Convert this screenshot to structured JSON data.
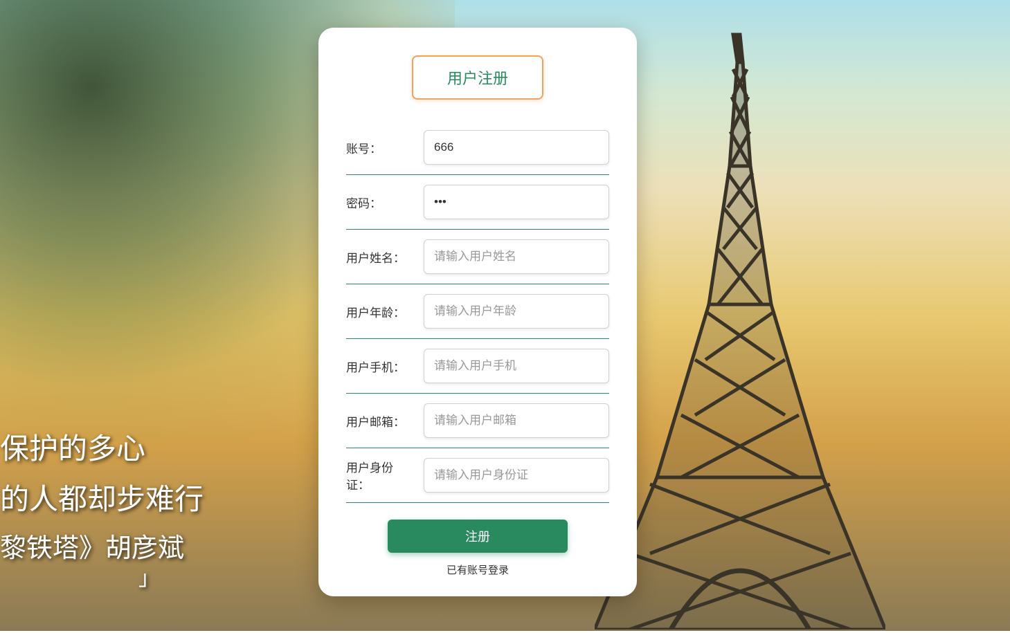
{
  "form": {
    "title": "用户注册",
    "fields": {
      "account": {
        "label": "账号：",
        "value": "666",
        "placeholder": ""
      },
      "password": {
        "label": "密码：",
        "value": "•••",
        "placeholder": ""
      },
      "name": {
        "label": "用户姓名：",
        "value": "",
        "placeholder": "请输入用户姓名"
      },
      "age": {
        "label": "用户年龄：",
        "value": "",
        "placeholder": "请输入用户年龄"
      },
      "phone": {
        "label": "用户手机：",
        "value": "",
        "placeholder": "请输入用户手机"
      },
      "email": {
        "label": "用户邮箱：",
        "value": "",
        "placeholder": "请输入用户邮箱"
      },
      "idcard": {
        "label": "用户身份证：",
        "value": "",
        "placeholder": "请输入用户身份证"
      }
    },
    "submit_label": "注册",
    "login_link": "已有账号登录"
  },
  "caption": {
    "line1": "保护的多心",
    "line2": "的人都却步难行",
    "line3": "黎铁塔》胡彦斌",
    "bracket": "」"
  }
}
